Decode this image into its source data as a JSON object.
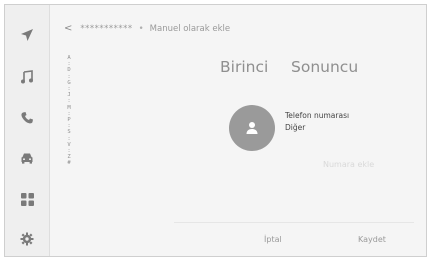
{
  "breadcrumb": {
    "back_icon": "chevron-left-icon",
    "masked_name": "***********",
    "separator": "•",
    "current": "Manuel olarak ekle"
  },
  "sidebar": {
    "items": [
      {
        "icon": "navigation-arrow-icon"
      },
      {
        "icon": "music-note-icon"
      },
      {
        "icon": "phone-icon",
        "active": true
      },
      {
        "icon": "car-icon"
      },
      {
        "icon": "apps-grid-icon"
      },
      {
        "icon": "gear-icon"
      }
    ]
  },
  "alpha_index": {
    "letters": "A\n:\nD\n:\nG\n:\nJ\n:\nM\n:\nP\n:\nS\n:\nV\n:\nZ\n#"
  },
  "contact": {
    "first_name": "Birinci",
    "last_name": "Sonuncu",
    "phone_label": "Telefon numarası",
    "phone_type": "Diğer",
    "add_number": "Numara ekle"
  },
  "actions": {
    "cancel": "İptal",
    "save": "Kaydet"
  }
}
